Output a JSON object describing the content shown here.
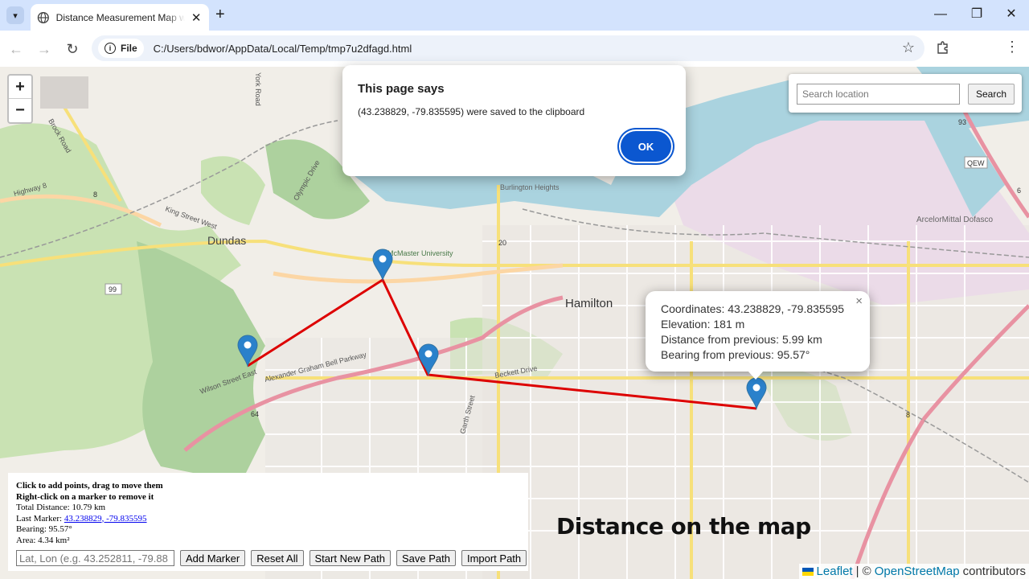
{
  "browser": {
    "tab_title": "Distance Measurement Map wi",
    "new_tab_label": "+",
    "url_chip": "File",
    "url": "C:/Users/bdwor/AppData/Local/Temp/tmp7u2dfagd.html",
    "icons": [
      "tab-search-icon",
      "globe-icon",
      "close-icon",
      "plus-icon",
      "minimize-icon",
      "maximize-icon",
      "close-window-icon",
      "back-icon",
      "forward-icon",
      "reload-icon",
      "info-icon",
      "star-icon",
      "extensions-icon",
      "kebab-menu-icon"
    ]
  },
  "alert": {
    "title": "This page says",
    "message": "(43.238829, -79.835595) were saved to the clipboard",
    "ok_label": "OK"
  },
  "map": {
    "zoom_in": "+",
    "zoom_out": "−",
    "search_placeholder": "Search location",
    "search_button": "Search",
    "labels": {
      "dundas": "Dundas",
      "hamilton": "Hamilton",
      "mcmaster": "McMaster University",
      "arcelor": "ArcelorMittal Dofasco",
      "qew": "QEW",
      "burlington_heights": "Burlington Heights",
      "highway": "Highway 8",
      "route_8": "8",
      "route_99": "99",
      "route_93": "93",
      "route_20": "20",
      "route_6": "6",
      "route_64": "64",
      "wilson": "Wilson Street East",
      "agb": "Alexander Graham Bell Parkway",
      "garth": "Garth Street",
      "beckett": "Beckett Drive",
      "king": "King Street West",
      "olympic": "Olympic Drive",
      "brock": "Brock Road",
      "york": "York Road"
    },
    "markers": [
      {
        "lat": 43.2656,
        "lon": -79.9182
      },
      {
        "lat": 43.2538,
        "lon": -79.9446
      },
      {
        "lat": 43.2463,
        "lon": -79.9082
      },
      {
        "lat": 43.238829,
        "lon": -79.835595
      }
    ],
    "path_color": "#dd0000",
    "popup": {
      "coordinates": "Coordinates: 43.238829, -79.835595",
      "elevation": "Elevation: 181 m",
      "distance": "Distance from previous: 5.99 km",
      "bearing": "Bearing from previous: 95.57°",
      "close": "×"
    },
    "attribution": {
      "leaflet": "Leaflet",
      "separator": "| ©",
      "osm": "OpenStreetMap",
      "contributors": "contributors"
    }
  },
  "panel": {
    "instruction1": "Click to add points, drag to move them",
    "instruction2": "Right-click on a marker to remove it",
    "total_distance": "Total Distance: 10.79 km",
    "last_marker_label": "Last Marker:",
    "last_marker_link": "43.238829, -79.835595",
    "bearing": "Bearing: 95.57°",
    "area": "Area: 4.34 km²",
    "coord_placeholder": "Lat, Lon (e.g. 43.252811, -79.88",
    "buttons": {
      "add_marker": "Add Marker",
      "reset_all": "Reset All",
      "start_new_path": "Start New Path",
      "save_path": "Save Path",
      "import_path": "Import Path"
    }
  },
  "caption": "Distance on the map"
}
